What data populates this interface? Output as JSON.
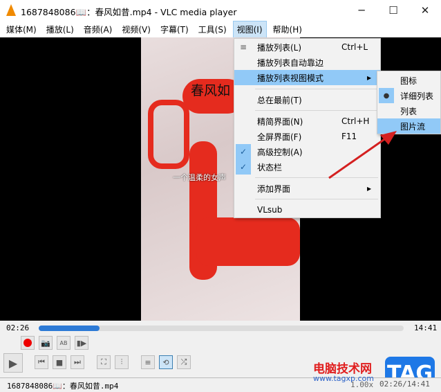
{
  "window": {
    "title": "1687848086📖：春风如昔.mp4 - VLC media player",
    "minimize": "─",
    "maximize": "☐",
    "close": "✕"
  },
  "menubar": [
    "媒体(M)",
    "播放(L)",
    "音频(A)",
    "视频(V)",
    "字幕(T)",
    "工具(S)",
    "视图(I)",
    "帮助(H)"
  ],
  "video": {
    "caption_title": "春风如",
    "subtitle": "一个温柔的女声"
  },
  "view_menu": {
    "items": [
      {
        "label": "播放列表(L)",
        "shortcut": "Ctrl+L"
      },
      {
        "label": "播放列表自动靠边"
      },
      {
        "label": "播放列表视图模式"
      },
      {
        "label": "总在最前(T)"
      },
      {
        "label": "精简界面(N)",
        "shortcut": "Ctrl+H"
      },
      {
        "label": "全屏界面(F)",
        "shortcut": "F11"
      },
      {
        "label": "高级控制(A)"
      },
      {
        "label": "状态栏"
      },
      {
        "label": "添加界面"
      },
      {
        "label": "VLsub"
      }
    ]
  },
  "submenu": {
    "items": [
      "图标",
      "详细列表",
      "列表",
      "图片流"
    ]
  },
  "player": {
    "elapsed": "02:26",
    "total": "14:41",
    "progress": 0.166
  },
  "status": {
    "filename": "1687848086📖：春风如昔.mp4",
    "speed": "1.00x",
    "time": "02:26/14:41"
  },
  "watermark": {
    "site": "电脑技术网",
    "url": "www.tagxp.com",
    "logo": "TAG"
  }
}
